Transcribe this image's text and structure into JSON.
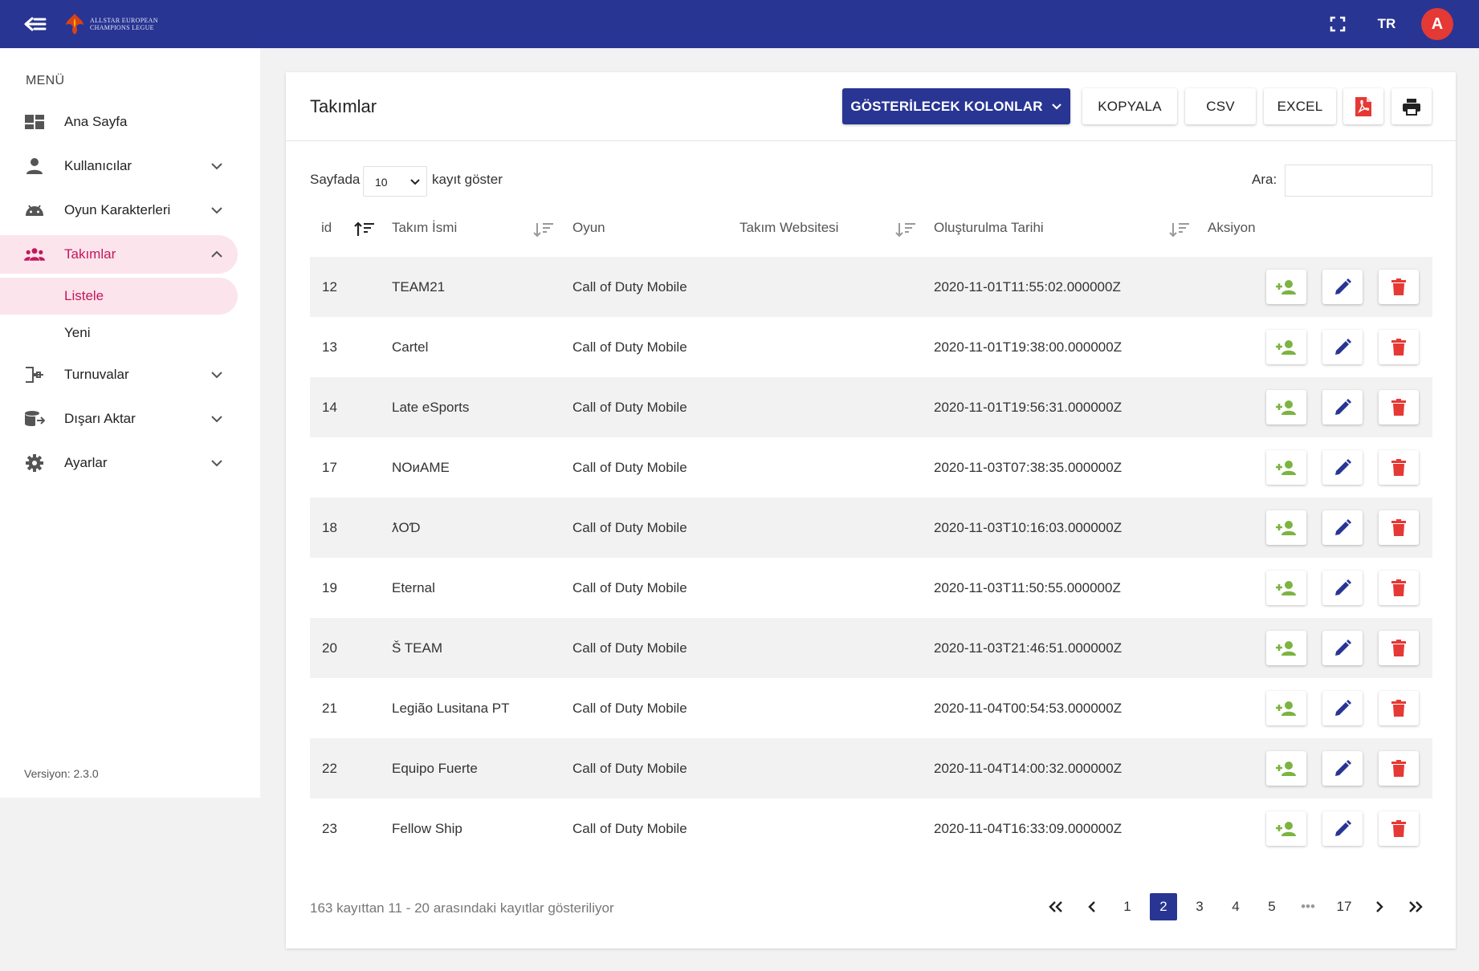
{
  "header": {
    "logo_text": "ALLSTAR EUROPEAN CHAMPIONS LEGUE",
    "lang": "TR",
    "avatar_letter": "A",
    "brand_color": "#283593",
    "avatar_color": "#e53935"
  },
  "sidebar": {
    "menu_title": "MENÜ",
    "items": [
      {
        "label": "Ana Sayfa",
        "icon": "dashboard-icon"
      },
      {
        "label": "Kullanıcılar",
        "icon": "person-icon"
      },
      {
        "label": "Oyun Karakterleri",
        "icon": "android-icon"
      },
      {
        "label": "Takımlar",
        "icon": "group-icon"
      },
      {
        "label": "Turnuvalar",
        "icon": "tournament-icon"
      },
      {
        "label": "Dışarı Aktar",
        "icon": "export-icon"
      },
      {
        "label": "Ayarlar",
        "icon": "gear-icon"
      }
    ],
    "subitems": [
      {
        "label": "Listele"
      },
      {
        "label": "Yeni"
      }
    ],
    "active_color": "#c2185b",
    "version": "Versiyon: 2.3.0"
  },
  "page": {
    "title": "Takımlar",
    "toolbar": {
      "columns_label": "GÖSTERİLECEK KOLONLAR",
      "copy_label": "KOPYALA",
      "csv_label": "CSV",
      "excel_label": "EXCEL"
    },
    "page_size_prefix": "Sayfada",
    "page_size_value": "10",
    "page_size_suffix": "kayıt göster",
    "search_label": "Ara:"
  },
  "table": {
    "columns": [
      "id",
      "Takım İsmi",
      "Oyun",
      "Takım Websitesi",
      "Oluşturulma Tarihi",
      "Aksiyon"
    ],
    "rows": [
      {
        "id": "12",
        "name": "TEAM21",
        "game": "Call of Duty Mobile",
        "website": "",
        "created": "2020-11-01T11:55:02.000000Z"
      },
      {
        "id": "13",
        "name": "Cartel",
        "game": "Call of Duty Mobile",
        "website": "",
        "created": "2020-11-01T19:38:00.000000Z"
      },
      {
        "id": "14",
        "name": "Late eSports",
        "game": "Call of Duty Mobile",
        "website": "",
        "created": "2020-11-01T19:56:31.000000Z"
      },
      {
        "id": "17",
        "name": "NOиAME",
        "game": "Call of Duty Mobile",
        "website": "",
        "created": "2020-11-03T07:38:35.000000Z"
      },
      {
        "id": "18",
        "name": "ƛOƊ",
        "game": "Call of Duty Mobile",
        "website": "",
        "created": "2020-11-03T10:16:03.000000Z"
      },
      {
        "id": "19",
        "name": "Eternal",
        "game": "Call of Duty Mobile",
        "website": "",
        "created": "2020-11-03T11:50:55.000000Z"
      },
      {
        "id": "20",
        "name": "Š TEAM",
        "game": "Call of Duty Mobile",
        "website": "",
        "created": "2020-11-03T21:46:51.000000Z"
      },
      {
        "id": "21",
        "name": "Legião Lusitana PT",
        "game": "Call of Duty Mobile",
        "website": "",
        "created": "2020-11-04T00:54:53.000000Z"
      },
      {
        "id": "22",
        "name": "Equipo Fuerte",
        "game": "Call of Duty Mobile",
        "website": "",
        "created": "2020-11-04T14:00:32.000000Z"
      },
      {
        "id": "23",
        "name": "Fellow Ship",
        "game": "Call of Duty Mobile",
        "website": "",
        "created": "2020-11-04T16:33:09.000000Z"
      }
    ],
    "action_colors": {
      "add": "#7cb342",
      "edit": "#283593",
      "delete": "#e53935"
    }
  },
  "footer": {
    "info": "163 kayıttan 11 - 20 arasındaki kayıtlar gösteriliyor",
    "pages": [
      "1",
      "2",
      "3",
      "4",
      "5",
      "•••",
      "17"
    ],
    "current_page": "2"
  }
}
